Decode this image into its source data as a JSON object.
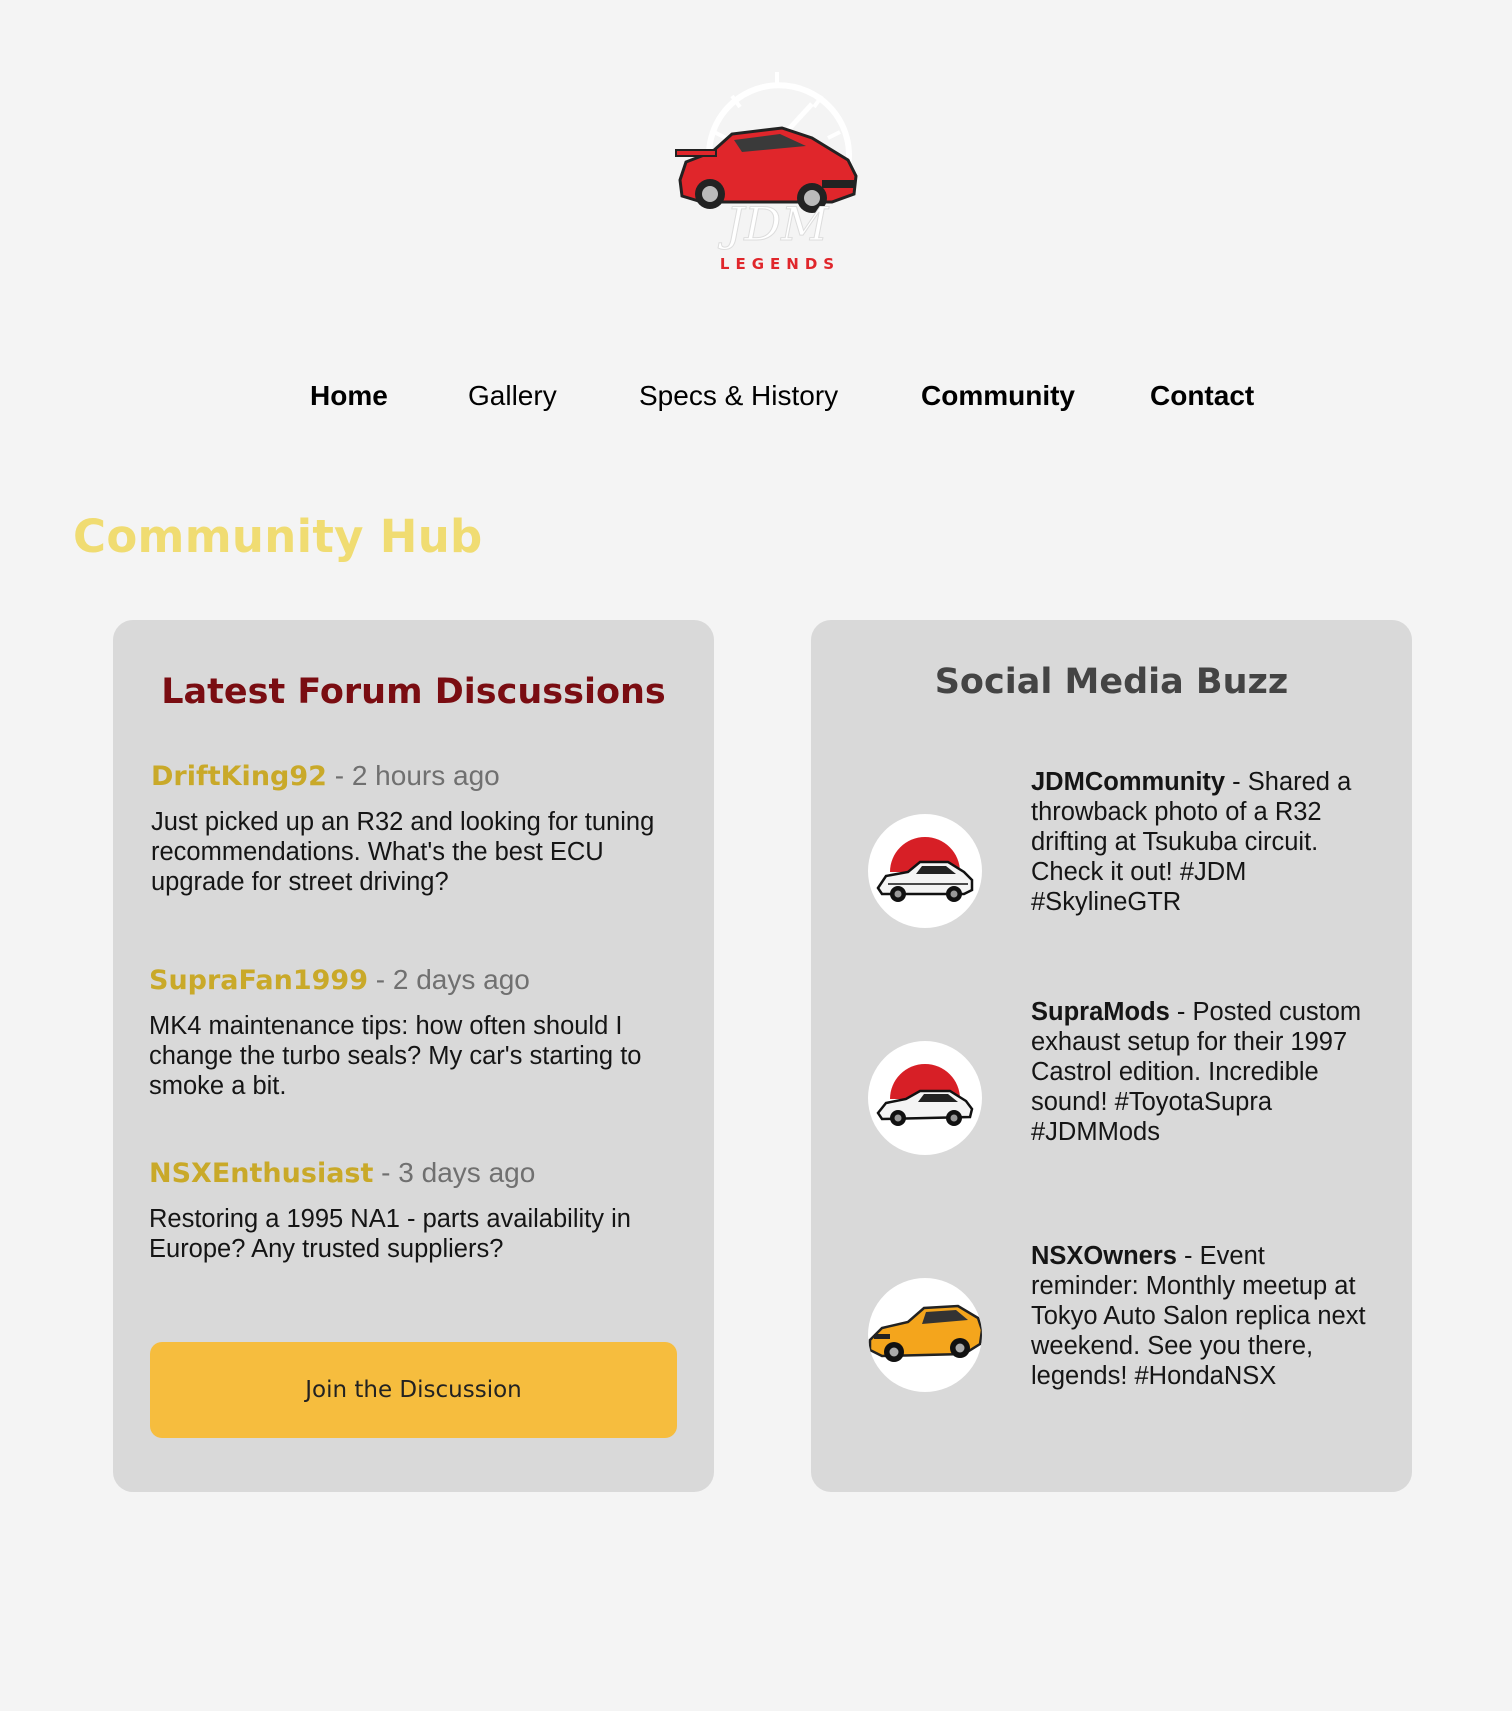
{
  "logo": {
    "script_text": "JDM",
    "word_text": "LEGENDS"
  },
  "nav": {
    "items": [
      {
        "label": "Home",
        "id": "home"
      },
      {
        "label": "Gallery",
        "id": "gallery"
      },
      {
        "label": "Specs & History",
        "id": "specs-history"
      },
      {
        "label": "Community",
        "id": "community"
      },
      {
        "label": "Contact",
        "id": "contact"
      }
    ]
  },
  "page": {
    "title": "Community Hub"
  },
  "forum": {
    "title": "Latest Forum Discussions",
    "posts": [
      {
        "user": "DriftKing92",
        "separator": " - ",
        "time": "2 hours ago",
        "body": "Just picked up an R32 and looking for tuning recommendations. What's the best ECU upgrade for street driving?"
      },
      {
        "user": "SupraFan1999",
        "separator": " - ",
        "time": "2 days ago",
        "body": "MK4 maintenance tips: how often should I change the turbo seals? My car's starting to smoke a bit."
      },
      {
        "user": "NSXEnthusiast",
        "separator": " - ",
        "time": "3 days ago",
        "body": "Restoring a 1995 NA1 - parts availability in Europe? Any trusted suppliers?"
      }
    ],
    "join_label": "Join the Discussion"
  },
  "social": {
    "title": "Social Media Buzz",
    "items": [
      {
        "handle": "JDMCommunity",
        "text": " - Shared a throwback photo of a R32 drifting at Tsukuba circuit. Check it out! #JDM #SkylineGTR",
        "icon": "r32-car-icon"
      },
      {
        "handle": "SupraMods",
        "text": " - Posted custom exhaust setup for their 1997 Castrol edition. Incredible sound! #ToyotaSupra #JDMMods",
        "icon": "supra-car-icon"
      },
      {
        "handle": "NSXOwners",
        "text": " - Event reminder: Monthly meetup at Tokyo Auto Salon replica next weekend. See you there, legends! #HondaNSX",
        "icon": "nsx-car-icon"
      }
    ]
  },
  "colors": {
    "background": "#f4f4f4",
    "hub_title": "#f0dc72",
    "card": "#d9d9d9",
    "forum_title": "#7a0d12",
    "social_title": "#444444",
    "username": "#c9a929",
    "button": "#f6bd3e",
    "logo_red": "#e0262b"
  }
}
